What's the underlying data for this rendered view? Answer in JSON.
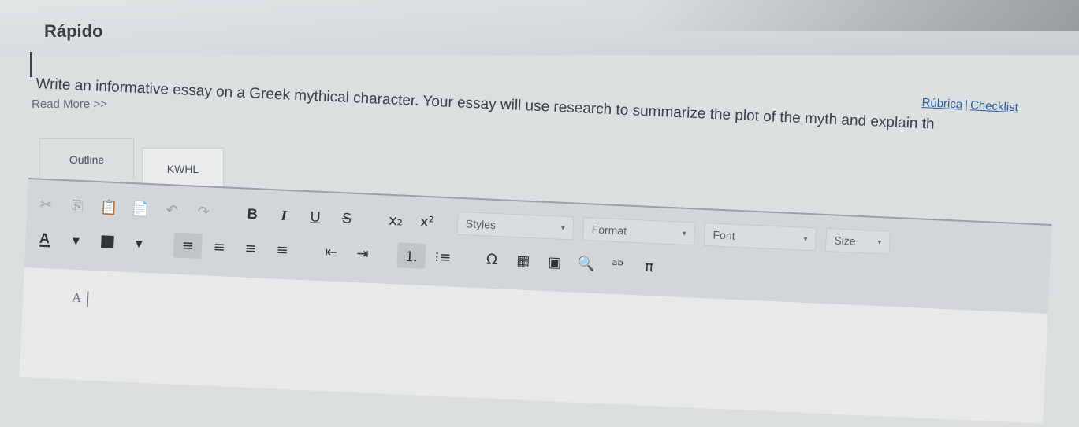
{
  "header": {
    "title": "Rápido",
    "prompt": "Write an informative essay on a Greek mythical character. Your essay will use research to summarize the plot of the myth and explain th",
    "read_more": "Read More >>",
    "rubric_link": "Rúbrica",
    "checklist_link": "Checklist",
    "separator": "|"
  },
  "tabs": [
    {
      "label": "Outline"
    },
    {
      "label": "KWHL"
    }
  ],
  "toolbar": {
    "row1": {
      "cut": "✂",
      "copy": "⎘",
      "paste": "📋",
      "paste_word": "📄",
      "undo": "↶",
      "redo": "↷",
      "bold": "B",
      "italic": "I",
      "underline": "U",
      "strike": "S",
      "subscript": "x₂",
      "superscript": "x²",
      "styles": "Styles",
      "format": "Format",
      "font": "Font",
      "size": "Size"
    },
    "row2": {
      "font_color": "A",
      "bg_color": "▇",
      "dropdown_caret": "▾",
      "align_left": "≡",
      "align_center": "≡",
      "align_right": "≡",
      "justify": "≡",
      "outdent": "⇤",
      "indent": "⇥",
      "ordered_list": "⒈",
      "bullet_list": "⁝≡",
      "special_char": "Ω",
      "table": "▦",
      "image": "▣",
      "find": "🔍",
      "spellcheck": "ᵃᵇ",
      "math": "π"
    }
  },
  "editor": {
    "typed_text": "A"
  },
  "icons": {
    "caret": "⌄"
  },
  "colors": {
    "link": "#2d5f9c",
    "toolbar_bg": "#d2d6d8",
    "page_bg": "#dcdfe0"
  }
}
